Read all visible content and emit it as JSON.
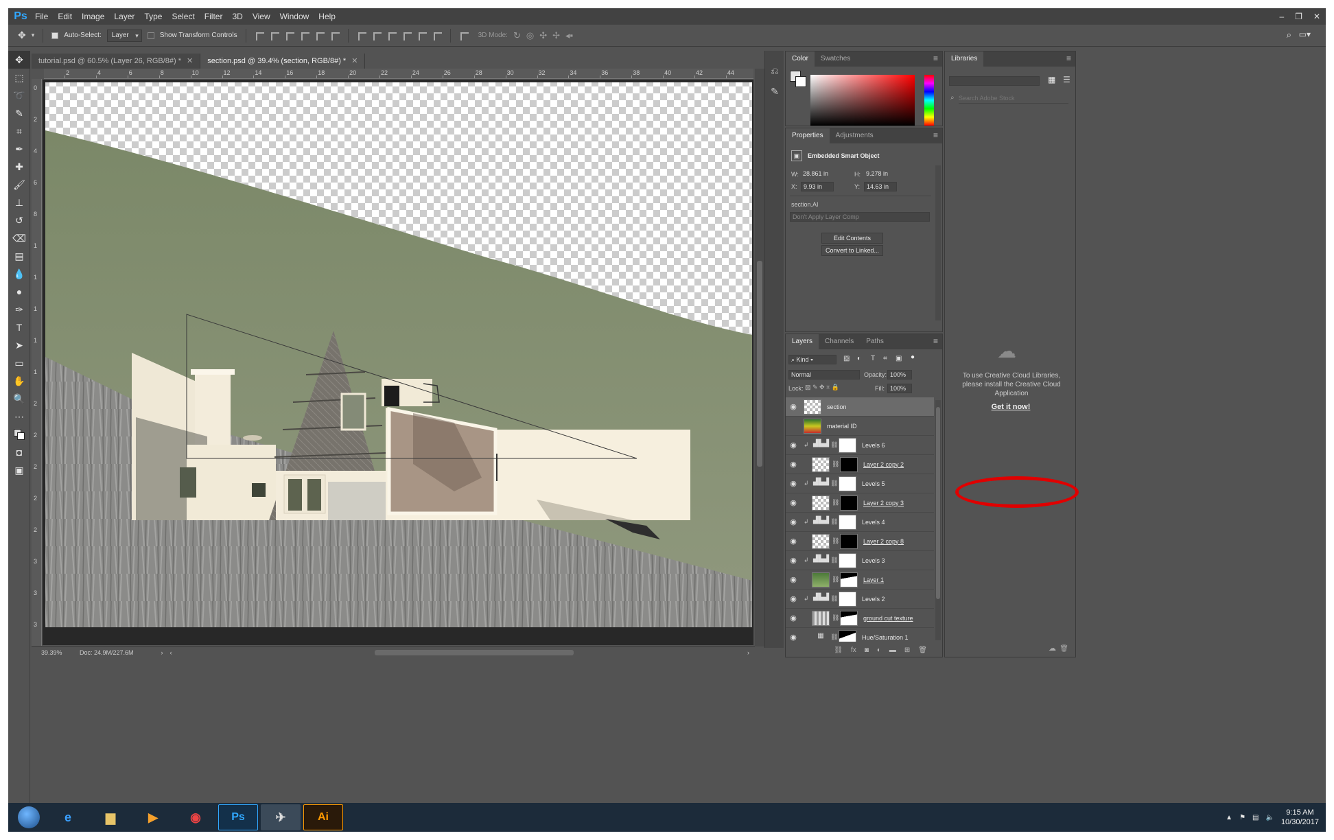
{
  "menu": [
    "File",
    "Edit",
    "Image",
    "Layer",
    "Type",
    "Select",
    "Filter",
    "3D",
    "View",
    "Window",
    "Help"
  ],
  "app_logo": "Ps",
  "options": {
    "auto_select_label": "Auto-Select:",
    "auto_select_value": "Layer",
    "show_transform_label": "Show Transform Controls",
    "mode_3d_label": "3D Mode:"
  },
  "tabs": [
    {
      "label": "tutorial.psd @ 60.5% (Layer 26, RGB/8#) *",
      "active": false
    },
    {
      "label": "section.psd @ 39.4% (section, RGB/8#) *",
      "active": true
    }
  ],
  "ruler_top": [
    "2",
    "4",
    "6",
    "8",
    "10",
    "12",
    "14",
    "16",
    "18",
    "20",
    "22",
    "24",
    "26",
    "28",
    "30",
    "32",
    "34",
    "36",
    "38",
    "40",
    "42",
    "44"
  ],
  "ruler_left": [
    "0",
    "2",
    "4",
    "6",
    "8",
    "1",
    "1",
    "1",
    "1",
    "1",
    "2",
    "2",
    "2",
    "2",
    "2",
    "3",
    "3",
    "3"
  ],
  "status": {
    "zoom": "39.39%",
    "doc": "Doc: 24.9M/227.6M"
  },
  "color_panel": {
    "tabs": [
      "Color",
      "Swatches"
    ]
  },
  "properties": {
    "tabs": [
      "Properties",
      "Adjustments"
    ],
    "type_label": "Embedded Smart Object",
    "w_label": "W:",
    "w_value": "28.861 in",
    "h_label": "H:",
    "h_value": "9.278 in",
    "x_label": "X:",
    "x_value": "9.93 in",
    "y_label": "Y:",
    "y_value": "14.63 in",
    "source_file": "section.AI",
    "layer_comp": "Don't Apply Layer Comp",
    "edit_contents": "Edit Contents",
    "convert_linked": "Convert to Linked..."
  },
  "layers_panel": {
    "tabs": [
      "Layers",
      "Channels",
      "Paths"
    ],
    "filter_kind": "Kind",
    "blend_mode": "Normal",
    "opacity_label": "Opacity:",
    "opacity_value": "100%",
    "lock_label": "Lock:",
    "fill_label": "Fill:",
    "fill_value": "100%",
    "layers": [
      {
        "name": "section",
        "visible": true,
        "selected": true,
        "kind": "smart"
      },
      {
        "name": "material ID",
        "visible": false,
        "selected": false,
        "kind": "image"
      },
      {
        "name": "Levels 6",
        "visible": true,
        "selected": false,
        "kind": "adjust"
      },
      {
        "name": "Layer 2 copy 2",
        "visible": true,
        "selected": false,
        "kind": "masked"
      },
      {
        "name": "Levels 5",
        "visible": true,
        "selected": false,
        "kind": "adjust"
      },
      {
        "name": "Layer 2 copy 3",
        "visible": true,
        "selected": false,
        "kind": "masked"
      },
      {
        "name": "Levels 4",
        "visible": true,
        "selected": false,
        "kind": "adjust"
      },
      {
        "name": "Layer 2 copy 8",
        "visible": true,
        "selected": false,
        "kind": "masked"
      },
      {
        "name": "Levels 3",
        "visible": true,
        "selected": false,
        "kind": "adjust"
      },
      {
        "name": "Layer 1",
        "visible": true,
        "selected": false,
        "kind": "masked-grass"
      },
      {
        "name": "Levels 2",
        "visible": true,
        "selected": false,
        "kind": "adjust"
      },
      {
        "name": "ground cut texture",
        "visible": true,
        "selected": false,
        "kind": "masked-texture"
      },
      {
        "name": "Hue/Saturation 1",
        "visible": true,
        "selected": false,
        "kind": "huesat"
      }
    ]
  },
  "libraries": {
    "tab": "Libraries",
    "search_placeholder": "Search Adobe Stock",
    "message": "To use Creative Cloud Libraries, please install the Creative Cloud Application",
    "link": "Get it now!"
  },
  "taskbar": {
    "time": "9:15 AM",
    "date": "10/30/2017",
    "apps": [
      "IE",
      "Explorer",
      "Media",
      "Chrome",
      "Ps",
      "Rhino",
      "Ai"
    ]
  },
  "colors": {
    "grass": "#7f8a6a",
    "ground": "#8e8e8c",
    "wall": "#efe8d6",
    "annotation": "#e00000"
  }
}
